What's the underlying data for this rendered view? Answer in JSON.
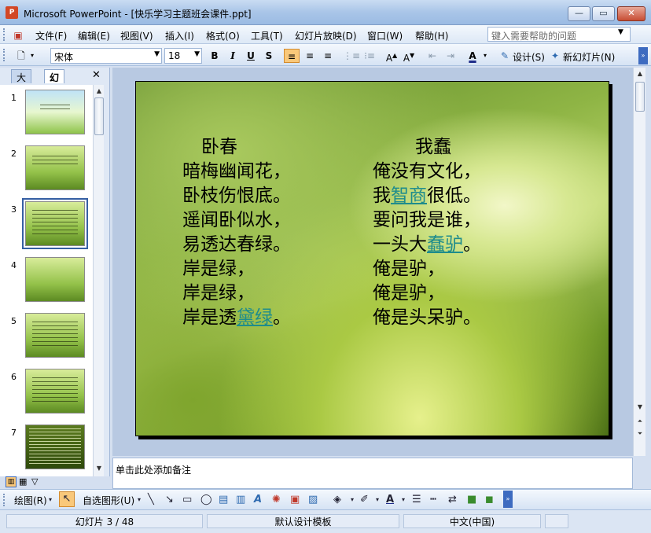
{
  "window": {
    "title": "Microsoft PowerPoint - [快乐学习主题班会课件.ppt]",
    "min": "—",
    "max": "▭",
    "close": "✕"
  },
  "menu": [
    "文件(F)",
    "编辑(E)",
    "视图(V)",
    "插入(I)",
    "格式(O)",
    "工具(T)",
    "幻灯片放映(D)",
    "窗口(W)",
    "帮助(H)"
  ],
  "help_placeholder": "键入需要帮助的问题",
  "format": {
    "font": "宋体",
    "size": "18",
    "design": "设计(S)",
    "new_slide": "新幻灯片(N)"
  },
  "panel_tabs": {
    "outline": "大纲",
    "slides": "幻灯片"
  },
  "slides": [
    {
      "num": "1"
    },
    {
      "num": "2"
    },
    {
      "num": "3"
    },
    {
      "num": "4"
    },
    {
      "num": "5"
    },
    {
      "num": "6"
    },
    {
      "num": "7"
    }
  ],
  "selected_slide": 3,
  "poem_left": {
    "title": "卧春",
    "lines": [
      "暗梅幽闻花，",
      "卧枝伤恨底。",
      "遥闻卧似水，",
      "易透达春绿。",
      "岸是绿，",
      "岸是绿，"
    ],
    "last_prefix": "岸是透",
    "last_link": "黛绿",
    "last_suffix": "。"
  },
  "poem_right": {
    "title": "我蠢",
    "l1": "俺没有文化，",
    "l2_prefix": "我",
    "l2_link": "智商",
    "l2_suffix": "很低。",
    "l3": "要问我是谁，",
    "l4_prefix": "一头大",
    "l4_link": "蠢驴",
    "l4_suffix": "。",
    "l5": "俺是驴，",
    "l6": "俺是驴，",
    "l7": "俺是头呆驴。"
  },
  "notes_placeholder": "单击此处添加备注",
  "drawing": {
    "draw": "绘图(R)",
    "autoshape": "自选图形(U)"
  },
  "status": {
    "slide": "幻灯片 3 / 48",
    "template": "默认设计模板",
    "lang": "中文(中国)"
  }
}
